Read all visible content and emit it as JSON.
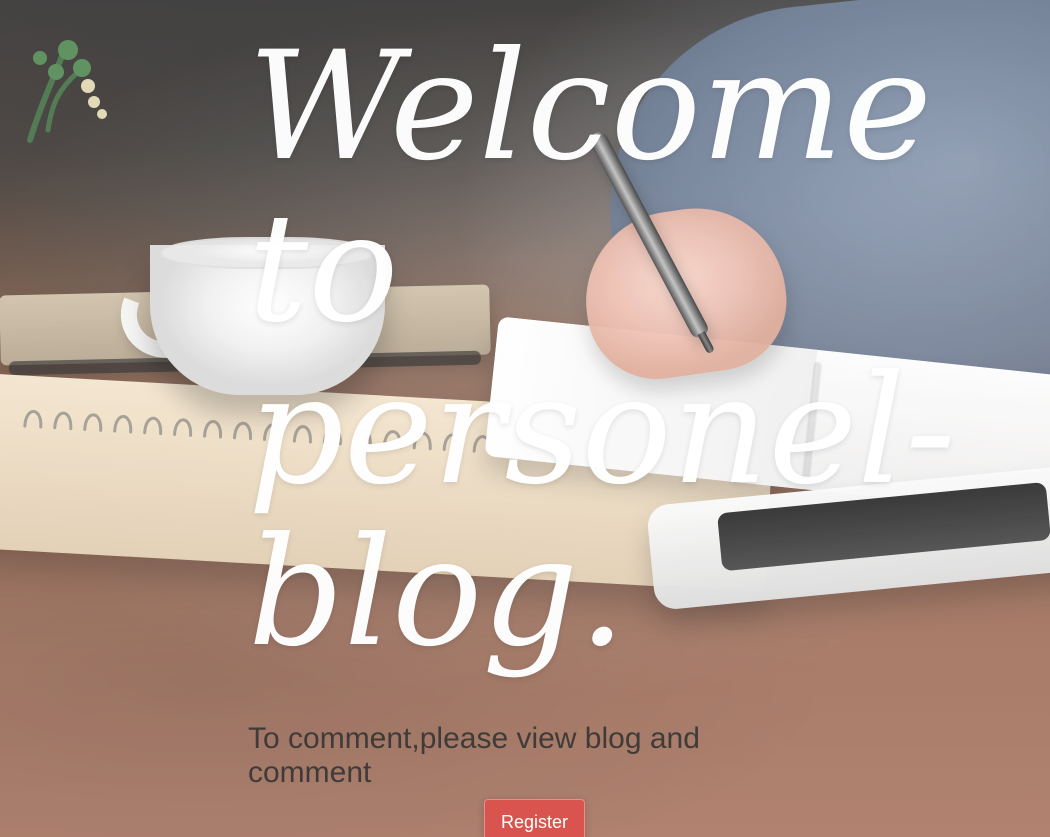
{
  "hero": {
    "title": "Welcome\nto\npersonel-\nblog.",
    "subtitle": "To comment,please view blog and comment",
    "cta_label": "Register"
  },
  "theme": {
    "primary_button_color": "#d9534f",
    "title_color": "#ffffff",
    "subtitle_color": "#333333"
  },
  "icons": {
    "background": "photo-background-icon"
  }
}
